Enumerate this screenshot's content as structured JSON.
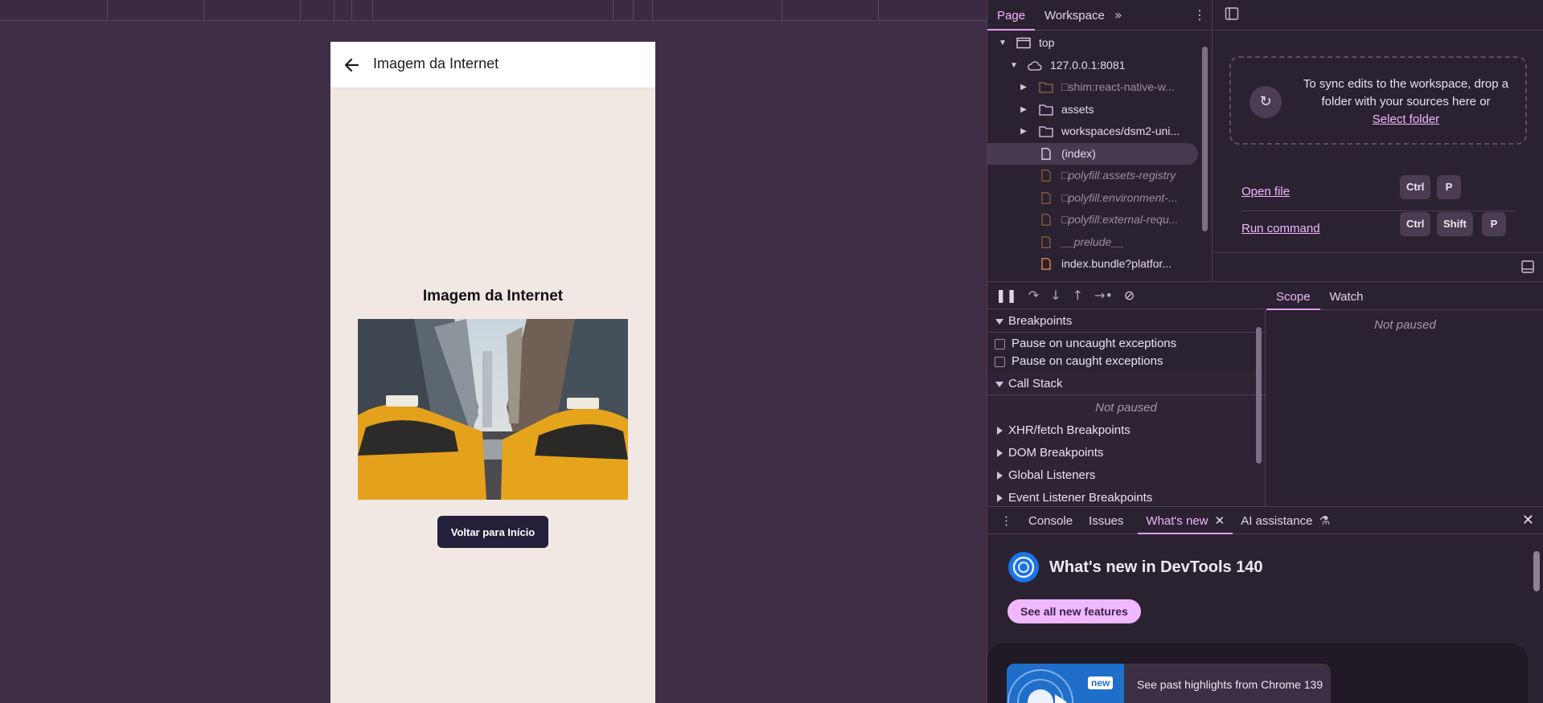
{
  "app": {
    "header_title": "Imagem da Internet",
    "content_title": "Imagem da Internet",
    "back_home_label": "Voltar para Início"
  },
  "sources": {
    "tabs": [
      "Page",
      "Workspace"
    ],
    "tree": [
      {
        "label": "top",
        "type": "frame"
      },
      {
        "label": "127.0.0.1:8081",
        "type": "cloud"
      },
      {
        "label": "□shim:react-native-w...",
        "type": "folder"
      },
      {
        "label": "assets",
        "type": "folder"
      },
      {
        "label": "workspaces/dsm2-uni...",
        "type": "folder"
      },
      {
        "label": "(index)",
        "type": "file"
      },
      {
        "label": "□polyfill:assets-registry",
        "type": "script"
      },
      {
        "label": "□polyfill:environment-...",
        "type": "script"
      },
      {
        "label": "□polyfill:external-requ...",
        "type": "script"
      },
      {
        "label": "__prelude__",
        "type": "script"
      },
      {
        "label": "index.bundle?platfor...",
        "type": "script"
      }
    ],
    "drop_text": "To sync edits to the workspace, drop a folder with your sources here or",
    "select_folder": "Select folder",
    "open_file": "Open file",
    "run_command": "Run command",
    "kbd_open": [
      "Ctrl",
      "P"
    ],
    "kbd_run": [
      "Ctrl",
      "Shift",
      "P"
    ]
  },
  "debugger": {
    "breakpoints": "Breakpoints",
    "pause_uncaught": "Pause on uncaught exceptions",
    "pause_caught": "Pause on caught exceptions",
    "call_stack": "Call Stack",
    "not_paused": "Not paused",
    "xhr": "XHR/fetch Breakpoints",
    "dom": "DOM Breakpoints",
    "global": "Global Listeners",
    "event": "Event Listener Breakpoints",
    "scope_tab": "Scope",
    "watch_tab": "Watch",
    "scope_not_paused": "Not paused"
  },
  "drawer": {
    "tabs": [
      "Console",
      "Issues",
      "What's new",
      "AI assistance"
    ],
    "whats_new_title": "What's new in DevTools 140",
    "see_all": "See all new features",
    "badge": "new",
    "highlight": "See past highlights from Chrome 139"
  },
  "colors": {
    "accent": "#f0b8ff",
    "page_bg": "#f2e8e3",
    "button_bg": "#22203a"
  }
}
